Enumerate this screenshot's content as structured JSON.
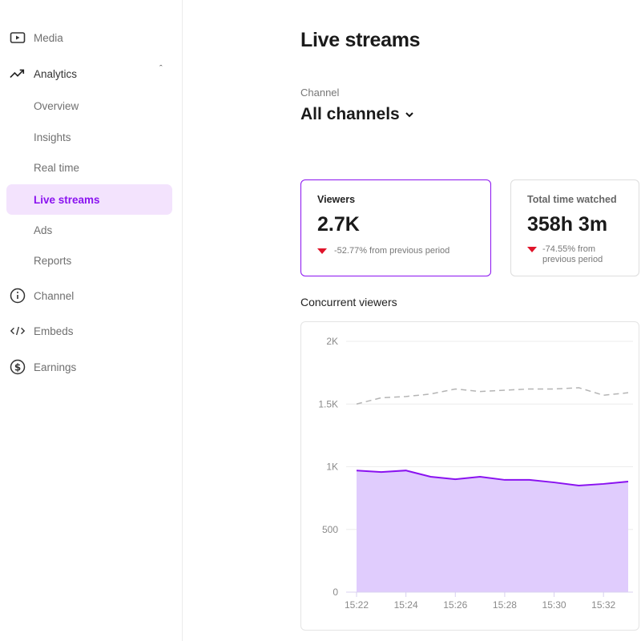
{
  "sidebar": {
    "items": [
      {
        "label": "Media",
        "icon": "play-icon"
      },
      {
        "label": "Analytics",
        "icon": "trending-up-icon",
        "expanded": true
      },
      {
        "label": "Channel",
        "icon": "info-icon"
      },
      {
        "label": "Embeds",
        "icon": "code-icon"
      },
      {
        "label": "Earnings",
        "icon": "dollar-icon"
      }
    ],
    "analytics_sub": [
      "Overview",
      "Insights",
      "Real time",
      "Live streams",
      "Ads",
      "Reports"
    ],
    "active": "Live streams"
  },
  "page": {
    "title": "Live streams",
    "channel_label": "Channel",
    "channel_value": "All channels"
  },
  "cards": [
    {
      "title": "Viewers",
      "value": "2.7K",
      "delta": "-52.77% from previous period"
    },
    {
      "title": "Total time watched",
      "value": "358h 3m",
      "delta": "-74.55% from previous period"
    }
  ],
  "colors": {
    "accent": "#8a12f0",
    "fill": "#e0ccfd",
    "down": "#e0142a"
  },
  "chart_data": {
    "type": "area",
    "title": "Concurrent viewers",
    "x": [
      "15:22",
      "15:23",
      "15:24",
      "15:25",
      "15:26",
      "15:27",
      "15:28",
      "15:29",
      "15:30",
      "15:31",
      "15:32",
      "15:33"
    ],
    "series": [
      {
        "values": [
          970,
          958,
          970,
          920,
          900,
          920,
          895,
          895,
          875,
          850,
          863,
          882
        ],
        "style": "area"
      },
      {
        "values": [
          1500,
          1550,
          1560,
          1580,
          1620,
          1600,
          1610,
          1620,
          1620,
          1630,
          1570,
          1590
        ],
        "style": "dashed"
      }
    ],
    "yticks": [
      "0",
      "500",
      "1K",
      "1.5K",
      "2K"
    ],
    "ytick_values": [
      0,
      500,
      1000,
      1500,
      2000
    ],
    "xticks": [
      "15:22",
      "15:24",
      "15:26",
      "15:28",
      "15:30",
      "15:32"
    ],
    "ylim": [
      0,
      2000
    ],
    "grid": true
  }
}
